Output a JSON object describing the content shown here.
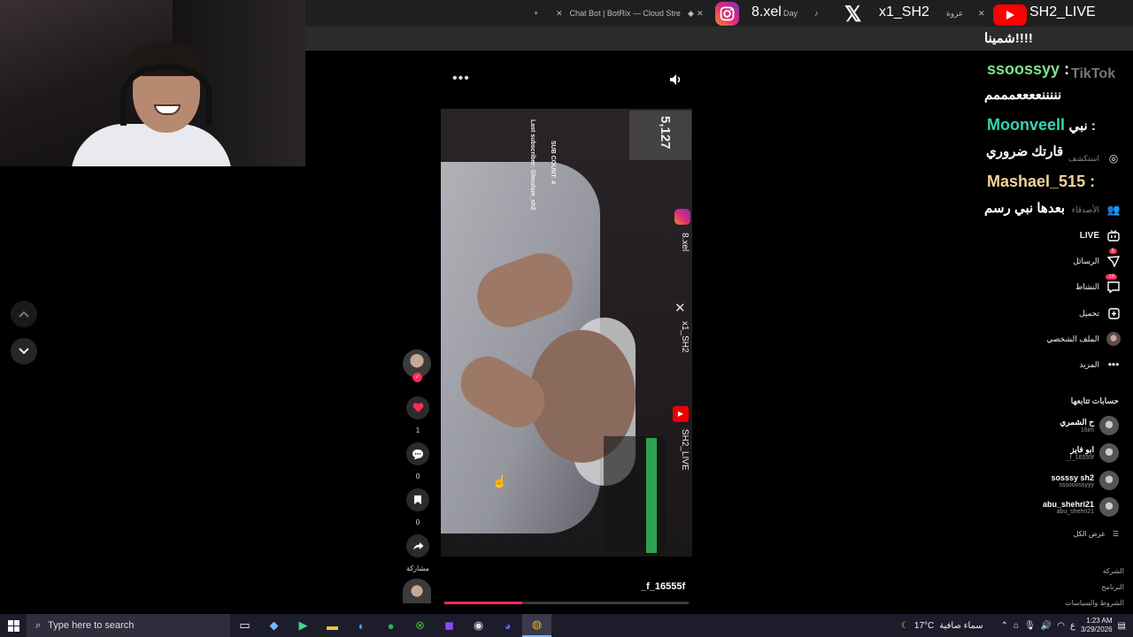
{
  "browser": {
    "tabs": [
      {
        "label": "Chat Bot | BotRix — Cloud Stre"
      },
      {
        "label": "Day"
      },
      {
        "label": "عروة"
      }
    ],
    "new_tab": "+",
    "close": "✕"
  },
  "overlay": {
    "instagram": "8.xel",
    "x": "x1_SH2",
    "youtube": "SH2_LIVE"
  },
  "video": {
    "sub_count": "5,127",
    "sub_label": "SUB COUNT: 4",
    "last_sub": "Last subscriber: Ghoulam_sh2",
    "ig_handle": "8.xel",
    "x_handle": "x1_SH2",
    "yt_handle": "SH2_LIVE",
    "author": "_f_16555f",
    "progress": 0.32
  },
  "actions": {
    "likes": "1",
    "comments": "0",
    "saves": "0",
    "share": "مشاركة"
  },
  "sidebar": {
    "logo": "TikTok",
    "nav": [
      {
        "label": "استكشف",
        "icon": "compass-icon"
      },
      {
        "label": "الأصدقاء",
        "icon": "friends-icon"
      },
      {
        "label": "LIVE",
        "icon": "live-icon"
      },
      {
        "label": "الرسائل",
        "icon": "messages-icon",
        "badge": "5"
      },
      {
        "label": "النشاط",
        "icon": "activity-icon",
        "badge": "19"
      },
      {
        "label": "تحميل",
        "icon": "upload-icon"
      },
      {
        "label": "الملف الشخصي",
        "icon": "profile-icon"
      },
      {
        "label": "المزيد",
        "icon": "more-icon"
      }
    ],
    "following_title": "حسابات تتابعها",
    "following": [
      {
        "name": "ح الشمري",
        "sub": "16im"
      },
      {
        "name": "ابو فايز",
        "sub": "_f_16555f"
      },
      {
        "name": "sosssy sh2",
        "sub": "sssooossyyy"
      },
      {
        "name": "abu_shehri21",
        "sub": "abu_shehri21"
      }
    ],
    "see_all": "عرض الكل",
    "footer": [
      "الشركة",
      "البرنامج",
      "الشروط والسياسات"
    ]
  },
  "chat": [
    {
      "user": "",
      "msg": "شمينا!!!!",
      "color": "#ffffff"
    },
    {
      "user": "ssoossyy",
      "msg": "نننننععععمممم",
      "color": "#7ee08a"
    },
    {
      "user": "Moonveell",
      "msg": "قارتك ضروري",
      "prefix": "نبي :",
      "color": "#35d6b0"
    },
    {
      "user": "Mashael_515",
      "msg": "بعدها نبي رسم",
      "color": "#f2d39b"
    }
  ],
  "taskbar": {
    "search_placeholder": "Type here to search",
    "temperature": "17°C",
    "weather": "سماء صافية",
    "lang": "ع",
    "time": "1:23 AM",
    "date": "3/29/2026"
  }
}
